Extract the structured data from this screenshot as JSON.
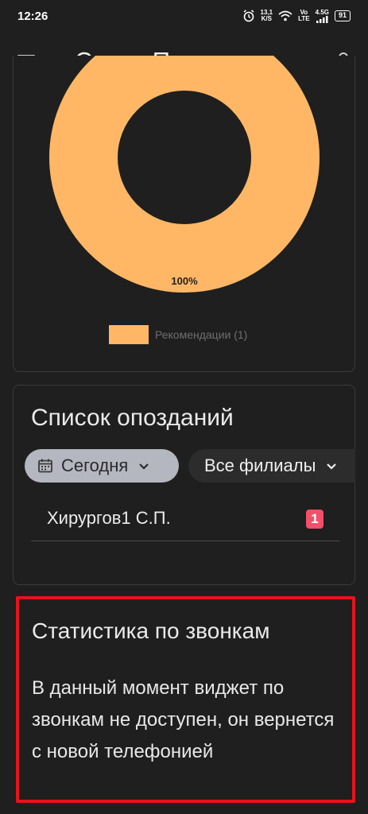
{
  "status_bar": {
    "time": "12:26",
    "speed_value": "13,1",
    "speed_unit": "K/S",
    "network_vo": "Vo",
    "network_lte": "LTE",
    "network_gen": "4.5G",
    "battery": "91"
  },
  "app_bar": {
    "title": "Супер Пользов..."
  },
  "recommendations_chart": {
    "chart_data": {
      "type": "pie",
      "categories": [
        "Рекомендации (1)"
      ],
      "values": [
        1
      ],
      "slice_labels": [
        "100%"
      ],
      "colors": [
        "#ffb766"
      ],
      "legend_position": "bottom"
    }
  },
  "late_list": {
    "title": "Список опозданий",
    "date_filter": "Сегодня",
    "branch_filter": "Все филиалы",
    "rows": [
      {
        "name": "Хирургов1 С.П.",
        "count": "1"
      }
    ]
  },
  "calls_stats": {
    "title": "Статистика по звонкам",
    "message": "В данный момент виджет по звонкам не доступен, он вернется с новой телефонией"
  },
  "colors": {
    "background": "#1f1f1f",
    "accent_orange": "#ffb766",
    "badge_red": "#f2506a",
    "highlight_red": "#e8121a"
  }
}
